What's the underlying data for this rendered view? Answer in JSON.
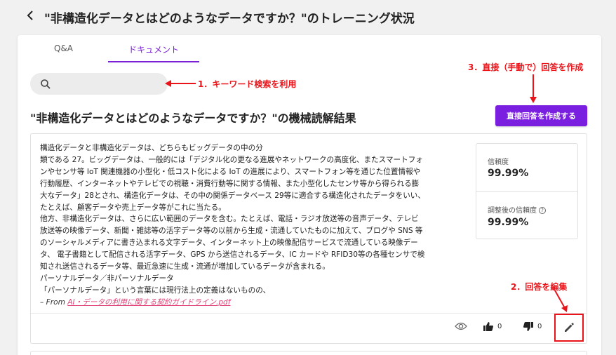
{
  "header": {
    "back_icon": "chevron-left-icon",
    "title": "\"非構造化データとはどのようなデータですか？\"のトレーニング状況"
  },
  "tabs": [
    {
      "label": "Q&A",
      "active": false
    },
    {
      "label": "ドキュメント",
      "active": true
    }
  ],
  "search": {
    "placeholder": "",
    "icon": "search-icon"
  },
  "annotations": {
    "keyword_search": "1．キーワード検索を利用",
    "edit_answer": "2．回答を編集",
    "direct_answer": "3．直接（手動で）回答を作成"
  },
  "section": {
    "title": "\"非構造化データとはどのようなデータですか？\"の機械読解結果",
    "create_button": "直接回答を作成する"
  },
  "result": {
    "lines": [
      "構造化データと非構造化データは、どちらもビッグデータの中の分",
      "類である 27。ビッグデータは、一般的には「デジタル化の更なる進展やネットワークの高度化、またスマートフォ",
      "ンやセンサ等 IoT 関連機器の小型化・低コスト化による IoT の進展により、スマートフォン等を通じた位置情報や",
      "行動履歴、インターネットやテレビでの視聴・消費行動等に関する情報、また小型化したセンサ等から得られる膨",
      "大なデータ」28とされ、構造化データは、その中の関係データベース 29等に適合する構造化されたデータをいい、",
      "たとえば、顧客データや売上データ等がこれに当たる。",
      "他方、非構造化データは、さらに広い範囲のデータを含む。たとえば、電話・ラジオ放送等の音声データ、テレビ",
      "放送等の映像データ、新聞・雑誌等の活字データ等の以前から生成・流通していたものに加えて、ブログや SNS 等",
      "のソーシャルメディアに書き込まれる文字データ、インターネット上の映像配信サービスで流通している映像デー",
      "タ、 電子書籍として配信される活字データ、GPS から送信されるデータ、IC カードや RFID30等の各種センサで検",
      "知され送信されるデータ等、最近急速に生成・流通が増加しているデータが含まれる。",
      "パーソナルデータ／非パーソナルデータ",
      "「パーソナルデータ」という言葉には現行法上の定義はないものの、"
    ],
    "source_prefix": "– From ",
    "source_link": "AI・データの利用に関する契約ガイドライン.pdf"
  },
  "scores": {
    "confidence_label": "信頼度",
    "confidence_value": "99.99%",
    "adjusted_label": "調整後の信頼度",
    "adjusted_value": "99.99%",
    "help_icon": "?"
  },
  "actions": {
    "view_icon": "eye-icon",
    "thumbs_up_count": "0",
    "thumbs_down_count": "0",
    "edit_icon": "pencil-icon"
  },
  "colors": {
    "accent": "#7a1ee0",
    "annotation": "#e8141a",
    "link": "#e0457a"
  }
}
